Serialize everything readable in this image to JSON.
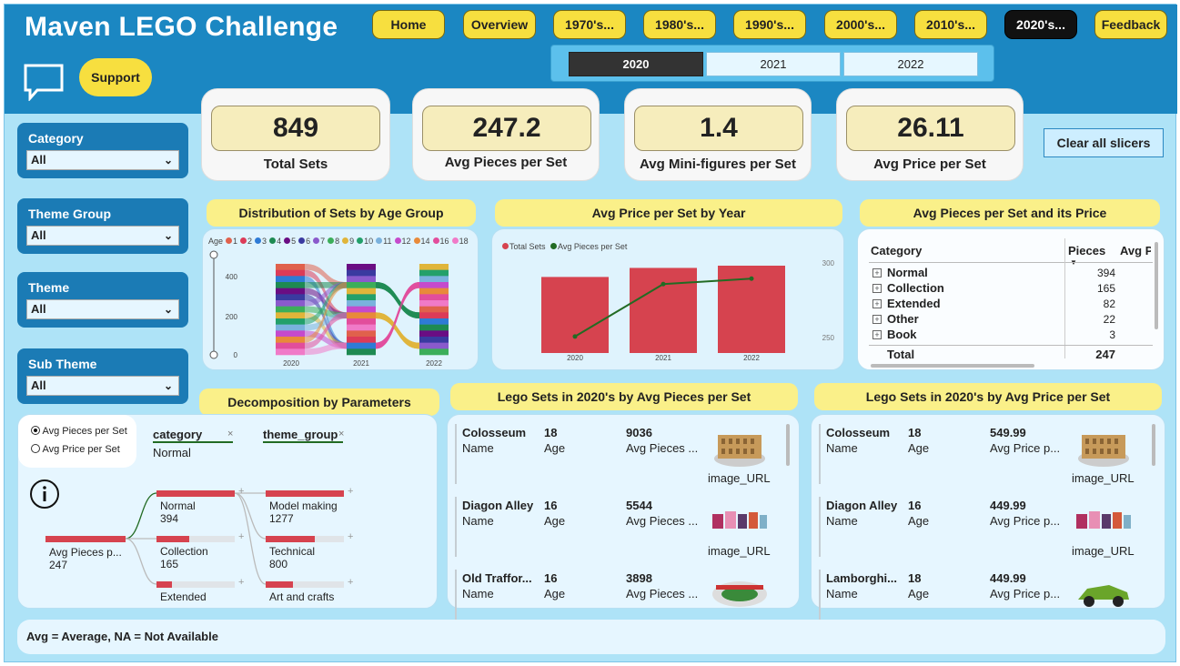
{
  "header": {
    "title": "Maven LEGO Challenge",
    "nav": [
      "Home",
      "Overview",
      "1970's...",
      "1980's...",
      "1990's...",
      "2000's...",
      "2010's...",
      "2020's...",
      "Feedback"
    ],
    "active_nav": "2020's...",
    "support_label": "Support"
  },
  "years": {
    "items": [
      "2020",
      "2021",
      "2022"
    ],
    "selected": "2020"
  },
  "kpis": [
    {
      "value": "849",
      "label": "Total Sets"
    },
    {
      "value": "247.2",
      "label": "Avg Pieces per Set"
    },
    {
      "value": "1.4",
      "label": "Avg Mini-figures per Set"
    },
    {
      "value": "26.11",
      "label": "Avg Price per Set"
    }
  ],
  "clear_label": "Clear all slicers",
  "slicers": [
    {
      "label": "Category",
      "value": "All"
    },
    {
      "label": "Theme Group",
      "value": "All"
    },
    {
      "label": "Theme",
      "value": "All"
    },
    {
      "label": "Sub Theme",
      "value": "All"
    }
  ],
  "age_chart": {
    "title": "Distribution of Sets by Age Group",
    "legend_title": "Age",
    "ages": [
      "1",
      "2",
      "3",
      "4",
      "5",
      "6",
      "7",
      "8",
      "9",
      "10",
      "11",
      "12",
      "14",
      "16",
      "18"
    ],
    "age_colors": [
      "#e0614c",
      "#dc3b58",
      "#2e7bd6",
      "#1e8a52",
      "#6a0d83",
      "#3a3aa0",
      "#8a5acc",
      "#3cae5a",
      "#e0b53a",
      "#23a06a",
      "#7ab2dd",
      "#c54acc",
      "#e88a3a",
      "#e24d9c",
      "#f07ac8"
    ],
    "y_ticks": [
      "400",
      "200",
      "0"
    ],
    "x_ticks": [
      "2020",
      "2021",
      "2022"
    ]
  },
  "price_chart": {
    "title": "Avg Price per Set by Year",
    "legend": [
      "Total Sets",
      "Avg Pieces per Set"
    ],
    "colors": {
      "bar": "#d6434f",
      "line": "#226b23"
    },
    "x_ticks": [
      "2020",
      "2021",
      "2022"
    ],
    "y2_ticks": [
      "300",
      "250"
    ]
  },
  "chart_data": {
    "type": "bar",
    "title": "Avg Price per Set by Year",
    "categories": [
      "2020",
      "2021",
      "2022"
    ],
    "series": [
      {
        "name": "Total Sets",
        "values": [
          849,
          950,
          975
        ]
      },
      {
        "name": "Avg Pieces per Set",
        "values": [
          247,
          285,
          289
        ]
      }
    ],
    "y2lim": [
      235,
      305
    ]
  },
  "matrix": {
    "title": "Avg Pieces per Set and its Price",
    "col_category": "Category",
    "col_pieces": "Pieces",
    "col_price": "Avg P",
    "rows": [
      {
        "name": "Normal",
        "pieces": "394"
      },
      {
        "name": "Collection",
        "pieces": "165"
      },
      {
        "name": "Extended",
        "pieces": "82"
      },
      {
        "name": "Other",
        "pieces": "22"
      },
      {
        "name": "Book",
        "pieces": "3"
      }
    ],
    "total_label": "Total",
    "total_value": "247"
  },
  "decomp": {
    "title": "Decomposition by Parameters",
    "options": [
      "Avg Pieces per Set",
      "Avg Price per Set"
    ],
    "selected_option": "Avg Pieces per Set",
    "level1": "category",
    "level1_value": "Normal",
    "level2": "theme_group",
    "root": {
      "label": "Avg Pieces p...",
      "value": "247"
    },
    "cat_nodes": [
      {
        "label": "Normal",
        "value": "394",
        "fill": 1.0
      },
      {
        "label": "Collection",
        "value": "165",
        "fill": 0.42
      },
      {
        "label": "Extended",
        "value": "",
        "fill": 0.2
      }
    ],
    "theme_nodes": [
      {
        "label": "Model making",
        "value": "1277",
        "fill": 1.0
      },
      {
        "label": "Technical",
        "value": "800",
        "fill": 0.63
      },
      {
        "label": "Art and crafts",
        "value": "",
        "fill": 0.35
      }
    ]
  },
  "pieces_list": {
    "title": "Lego Sets in 2020's by Avg Pieces per Set",
    "col_name": "Name",
    "col_age": "Age",
    "col_metric": "Avg Pieces ...",
    "col_image": "image_URL",
    "items": [
      {
        "name": "Colosseum",
        "age": "18",
        "metric": "9036"
      },
      {
        "name": "Diagon Alley",
        "age": "16",
        "metric": "5544"
      },
      {
        "name": "Old Traffor...",
        "age": "16",
        "metric": "3898"
      }
    ]
  },
  "price_list": {
    "title": "Lego Sets in 2020's by Avg Price per Set",
    "col_name": "Name",
    "col_age": "Age",
    "col_metric": "Avg Price p...",
    "col_image": "image_URL",
    "items": [
      {
        "name": "Colosseum",
        "age": "18",
        "metric": "549.99"
      },
      {
        "name": "Diagon Alley",
        "age": "16",
        "metric": "449.99"
      },
      {
        "name": "Lamborghi...",
        "age": "18",
        "metric": "449.99"
      }
    ]
  },
  "footer": "Avg = Average, NA = Not Available"
}
